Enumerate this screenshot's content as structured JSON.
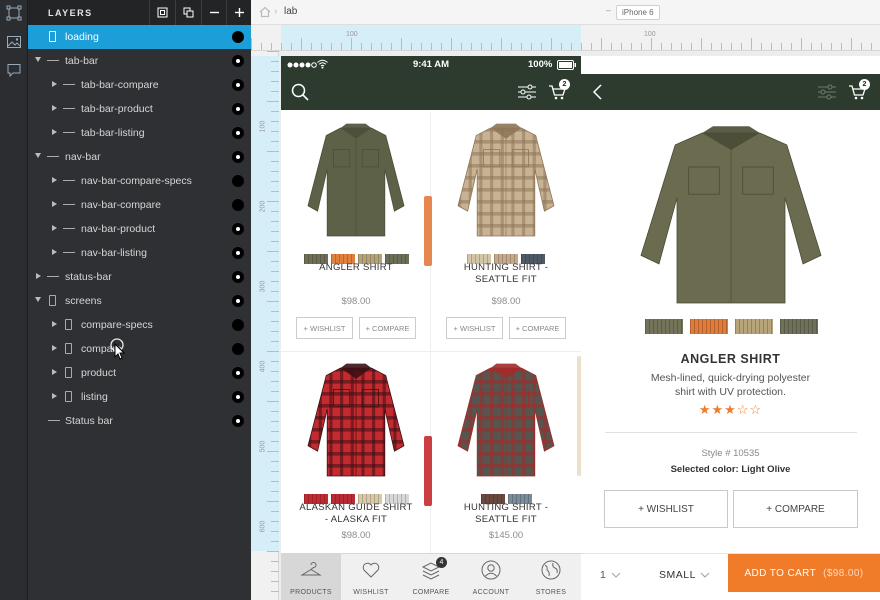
{
  "layers": {
    "title": "LAYERS",
    "items": [
      {
        "label": "loading",
        "depth": 0,
        "expand": "none",
        "icon": "rect",
        "selected": true,
        "vis": "filled"
      },
      {
        "label": "tab-bar",
        "depth": 0,
        "expand": "open",
        "icon": "line",
        "selected": false,
        "vis": "ring"
      },
      {
        "label": "tab-bar-compare",
        "depth": 1,
        "expand": "closed",
        "icon": "line",
        "selected": false,
        "vis": "ring"
      },
      {
        "label": "tab-bar-product",
        "depth": 1,
        "expand": "closed",
        "icon": "line",
        "selected": false,
        "vis": "ring"
      },
      {
        "label": "tab-bar-listing",
        "depth": 1,
        "expand": "closed",
        "icon": "line",
        "selected": false,
        "vis": "ring"
      },
      {
        "label": "nav-bar",
        "depth": 0,
        "expand": "open",
        "icon": "line",
        "selected": false,
        "vis": "ring"
      },
      {
        "label": "nav-bar-compare-specs",
        "depth": 1,
        "expand": "closed",
        "icon": "line",
        "selected": false,
        "vis": "filled"
      },
      {
        "label": "nav-bar-compare",
        "depth": 1,
        "expand": "closed",
        "icon": "line",
        "selected": false,
        "vis": "filled"
      },
      {
        "label": "nav-bar-product",
        "depth": 1,
        "expand": "closed",
        "icon": "line",
        "selected": false,
        "vis": "ring"
      },
      {
        "label": "nav-bar-listing",
        "depth": 1,
        "expand": "closed",
        "icon": "line",
        "selected": false,
        "vis": "ring"
      },
      {
        "label": "status-bar",
        "depth": 0,
        "expand": "closed",
        "icon": "line",
        "selected": false,
        "vis": "ring"
      },
      {
        "label": "screens",
        "depth": 0,
        "expand": "open",
        "icon": "rect",
        "selected": false,
        "vis": "ring"
      },
      {
        "label": "compare-specs",
        "depth": 1,
        "expand": "closed",
        "icon": "rect",
        "selected": false,
        "vis": "filled"
      },
      {
        "label": "compare",
        "depth": 1,
        "expand": "closed",
        "icon": "rect",
        "selected": false,
        "vis": "filled"
      },
      {
        "label": "product",
        "depth": 1,
        "expand": "closed",
        "icon": "rect",
        "selected": false,
        "vis": "ring"
      },
      {
        "label": "listing",
        "depth": 1,
        "expand": "closed",
        "icon": "rect",
        "selected": false,
        "vis": "ring"
      },
      {
        "label": "Status bar",
        "depth": 0,
        "expand": "none",
        "icon": "line",
        "selected": false,
        "vis": "ring"
      }
    ]
  },
  "canvas": {
    "breadcrumb": "lab",
    "device": "iPhone 6",
    "ruler_top": [
      "100",
      "100"
    ],
    "ruler_left": [
      "100",
      "200",
      "300",
      "400",
      "500",
      "600"
    ]
  },
  "listing": {
    "status": {
      "time": "9:41 AM",
      "battery": "100%"
    },
    "cart_count": "2",
    "products": [
      {
        "name": "ANGLER SHIRT",
        "price": "$98.00",
        "shirt": "#5d6147",
        "shirt2": "#4b4f38",
        "plaid": false,
        "swatches": [
          "#6e6f55",
          "#e0803f",
          "#b3a37a",
          "#6d6e57"
        ]
      },
      {
        "name": "HUNTING SHIRT - SEATTLE FIT",
        "price": "$98.00",
        "shirt": "#c7b394",
        "shirt2": "#8e7658",
        "plaid": true,
        "swatches": [
          "#d3c5a8",
          "#c6a98a",
          "#4e5b66"
        ]
      },
      {
        "name": "ALASKAN GUIDE SHIRT - ALASKA FIT",
        "price": "$98.00",
        "shirt": "#c52a2f",
        "shirt2": "#3b1115",
        "plaid": true,
        "swatches": [
          "#c12a30",
          "#b82b34",
          "#d7c9a6",
          "#d8d8d8"
        ]
      },
      {
        "name": "HUNTING SHIRT - SEATTLE FIT",
        "price": "$145.00",
        "shirt": "#56564e",
        "shirt2": "#a22b2b",
        "plaid": true,
        "swatches": [
          "#6a4a40",
          "#7a8b9c"
        ]
      }
    ],
    "wishlist": "+ WISHLIST",
    "compare": "+ COMPARE",
    "tabs": [
      {
        "label": "PRODUCTS",
        "icon": "hanger-icon",
        "active": true
      },
      {
        "label": "WISHLIST",
        "icon": "heart-icon",
        "active": false
      },
      {
        "label": "COMPARE",
        "icon": "compare-icon",
        "active": false,
        "badge": "4"
      },
      {
        "label": "ACCOUNT",
        "icon": "account-icon",
        "active": false
      },
      {
        "label": "STORES",
        "icon": "globe-icon",
        "active": false
      }
    ]
  },
  "detail": {
    "cart_count": "2",
    "name": "ANGLER SHIRT",
    "desc_line1": "Mesh-lined, quick-drying polyester",
    "desc_line2": "shirt with UV protection.",
    "rating": 3,
    "rating_max": 5,
    "style": "Style # 10535",
    "selected_color": "Selected color: Light Olive",
    "swatches": [
      "#74745a",
      "#e07b3a",
      "#b8a47a",
      "#6f715a"
    ],
    "wishlist": "+ WISHLIST",
    "compare": "+ COMPARE",
    "qty": "1",
    "size": "SMALL",
    "add_to_cart": "ADD TO CART",
    "add_price": "($98.00)",
    "accent": "#f07c2a",
    "star_color": "#f07c2a"
  },
  "colors": {
    "nav": "#2d3b2e",
    "select": "#1c9fd8",
    "panel": "#2f3033"
  }
}
